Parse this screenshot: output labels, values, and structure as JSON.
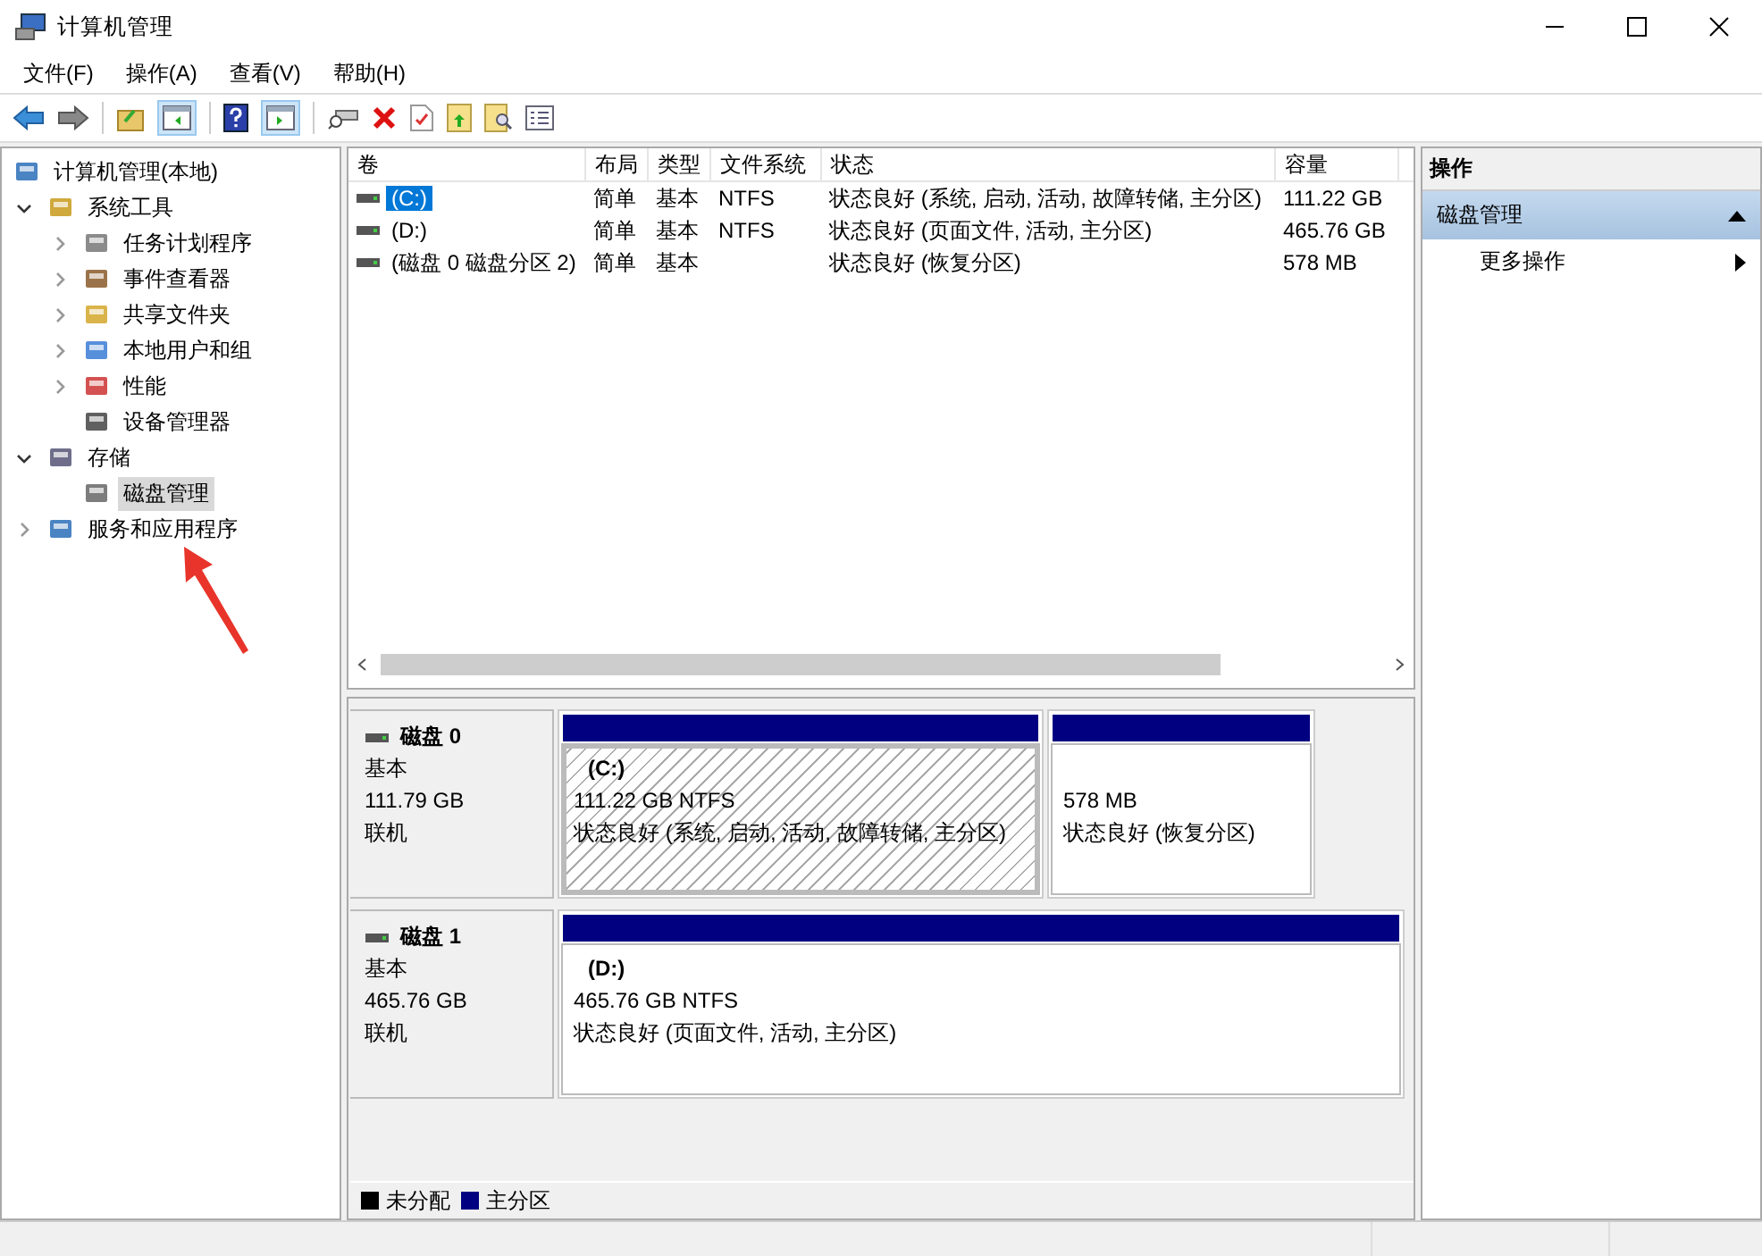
{
  "window": {
    "title": "计算机管理"
  },
  "menu": [
    "文件(F)",
    "操作(A)",
    "查看(V)",
    "帮助(H)"
  ],
  "tree": {
    "label": "计算机管理(本地)",
    "children": [
      {
        "label": "系统工具",
        "expanded": true,
        "children": [
          {
            "label": "任务计划程序",
            "expanded": false
          },
          {
            "label": "事件查看器",
            "expanded": false
          },
          {
            "label": "共享文件夹",
            "expanded": false
          },
          {
            "label": "本地用户和组",
            "expanded": false
          },
          {
            "label": "性能",
            "expanded": false
          },
          {
            "label": "设备管理器"
          }
        ]
      },
      {
        "label": "存储",
        "expanded": true,
        "children": [
          {
            "label": "磁盘管理",
            "selected": true
          }
        ]
      },
      {
        "label": "服务和应用程序",
        "expanded": false
      }
    ]
  },
  "volume_table": {
    "columns": [
      "卷",
      "布局",
      "类型",
      "文件系统",
      "状态",
      "容量"
    ],
    "rows": [
      {
        "selected": true,
        "cells": [
          "(C:)",
          "简单",
          "基本",
          "NTFS",
          "状态良好 (系统, 启动, 活动, 故障转储, 主分区)",
          "111.22 GB"
        ]
      },
      {
        "selected": false,
        "cells": [
          "(D:)",
          "简单",
          "基本",
          "NTFS",
          "状态良好 (页面文件, 活动, 主分区)",
          "465.76 GB"
        ]
      },
      {
        "selected": false,
        "cells": [
          "(磁盘 0 磁盘分区 2)",
          "简单",
          "基本",
          "",
          "状态良好 (恢复分区)",
          "578 MB"
        ]
      }
    ]
  },
  "disks": [
    {
      "name": "磁盘 0",
      "type": "基本",
      "size": "111.79 GB",
      "status": "联机",
      "partitions": [
        {
          "selected": true,
          "label": "(C:)",
          "size": "111.22 GB NTFS",
          "status": "状态良好 (系统, 启动, 活动, 故障转储, 主分区)"
        },
        {
          "selected": false,
          "size": "578 MB",
          "status": "状态良好 (恢复分区)"
        }
      ]
    },
    {
      "name": "磁盘 1",
      "type": "基本",
      "size": "465.76 GB",
      "status": "联机",
      "partitions": [
        {
          "selected": false,
          "label": "(D:)",
          "size": "465.76 GB NTFS",
          "status": "状态良好 (页面文件, 活动, 主分区)"
        }
      ]
    }
  ],
  "legend": [
    {
      "label": "未分配",
      "color": "#000000"
    },
    {
      "label": "主分区",
      "color": "#000080"
    }
  ],
  "actions": {
    "title": "操作",
    "section": {
      "label": "磁盘管理",
      "expanded": true
    },
    "items": [
      "更多操作"
    ]
  }
}
